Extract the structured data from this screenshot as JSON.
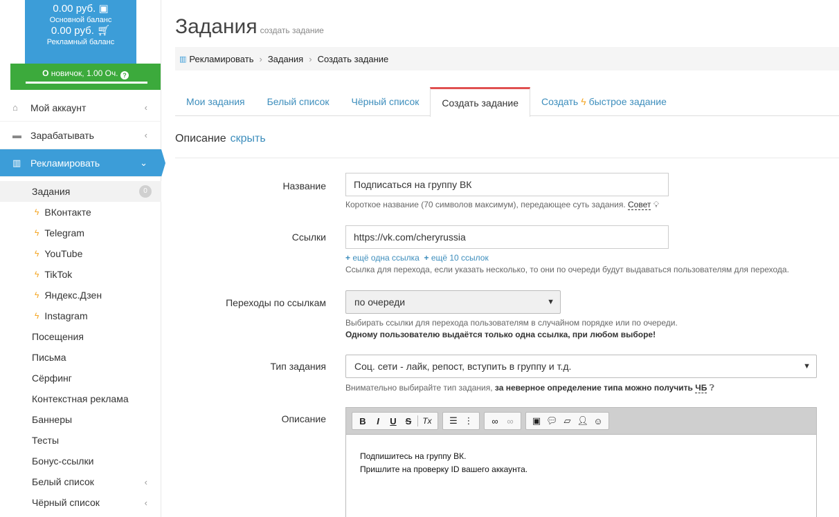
{
  "balance": {
    "main_amount": "0.00 руб.",
    "main_label": "Основной баланс",
    "ad_amount": "0.00 руб.",
    "ad_label": "Рекламный баланс",
    "level": "новичок, 1.00 Оч."
  },
  "nav": {
    "account": "Мой аккаунт",
    "earn": "Зарабатывать",
    "advertise": "Рекламировать"
  },
  "submenu": {
    "tasks": "Задания",
    "tasks_badge": "0",
    "vk": "ВКонтакте",
    "telegram": "Telegram",
    "youtube": "YouTube",
    "tiktok": "TikTok",
    "dzen": "Яндекс.Дзен",
    "instagram": "Instagram",
    "visits": "Посещения",
    "letters": "Письма",
    "surfing": "Сёрфинг",
    "context": "Контекстная реклама",
    "banners": "Баннеры",
    "tests": "Тесты",
    "bonus": "Бонус-ссылки",
    "whitelist": "Белый список",
    "blacklist": "Чёрный список"
  },
  "page": {
    "title": "Задания",
    "subtitle": "создать задание"
  },
  "breadcrumb": {
    "root": "Рекламировать",
    "mid": "Задания",
    "current": "Создать задание"
  },
  "tabs": {
    "my_tasks": "Мои задания",
    "white": "Белый список",
    "black": "Чёрный список",
    "create": "Создать задание",
    "quick_prefix": "Создать",
    "quick_suffix": "быстрое задание"
  },
  "section": {
    "title": "Описание",
    "toggle": "скрыть"
  },
  "form": {
    "name_label": "Название",
    "name_value": "Подписаться на группу ВК",
    "name_help": "Короткое название (70 символов максимум), передающее суть задания.",
    "name_tip": "Совет",
    "links_label": "Ссылки",
    "links_value": "https://vk.com/cheryrussia",
    "add_one": "ещё одна ссылка",
    "add_ten": "ещё 10 ссылок",
    "links_help": "Ссылка для перехода, если указать несколько, то они по очереди будут выдаваться пользователям для перехода.",
    "order_label": "Переходы по ссылкам",
    "order_value": "по очереди",
    "order_help": "Выбирать ссылки для перехода пользователям в случайном порядке или по очереди.",
    "order_help_bold": "Одному пользователю выдаётся только одна ссылка, при любом выборе!",
    "type_label": "Тип задания",
    "type_value": "Соц. сети - лайк, репост, вступить в группу и т.д.",
    "type_help": "Внимательно выбирайте тип задания,",
    "type_help_bold": "за неверное определение типа можно получить",
    "type_help_tag": "ЧБ",
    "desc_label": "Описание",
    "desc_line1": "Подпишитесь на группу ВК.",
    "desc_line2": "Пришлите на проверку ID вашего аккаунта."
  },
  "toolbar": {
    "bold": "B",
    "italic": "I",
    "underline": "U",
    "strike": "S",
    "clear": "Tx"
  }
}
